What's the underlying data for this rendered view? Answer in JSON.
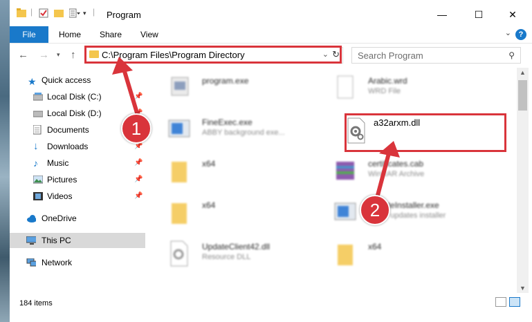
{
  "window": {
    "title": "Program",
    "minimize": "—",
    "maximize": "☐",
    "close": "✕"
  },
  "ribbon": {
    "tabs": [
      "File",
      "Home",
      "Share",
      "View"
    ],
    "help": "?"
  },
  "address": {
    "path": "C:\\Program Files\\Program Directory"
  },
  "search": {
    "placeholder": "Search Program"
  },
  "nav_pane": {
    "items": [
      {
        "label": "Quick access",
        "icon": "star-icon"
      },
      {
        "label": "Local Disk (C:)",
        "icon": "drive-icon"
      },
      {
        "label": "Local Disk (D:)",
        "icon": "drive-icon"
      },
      {
        "label": "Documents",
        "icon": "documents-icon"
      },
      {
        "label": "Downloads",
        "icon": "download-icon"
      },
      {
        "label": "Music",
        "icon": "music-icon"
      },
      {
        "label": "Pictures",
        "icon": "pictures-icon"
      },
      {
        "label": "Videos",
        "icon": "videos-icon"
      },
      {
        "label": "OneDrive",
        "icon": "cloud-icon"
      },
      {
        "label": "This PC",
        "icon": "computer-icon"
      },
      {
        "label": "Network",
        "icon": "network-icon"
      }
    ]
  },
  "files": [
    {
      "name": "program.exe",
      "desc": "",
      "icon": "exe-icon"
    },
    {
      "name": "Arabic.wrd",
      "desc": "WRD File",
      "icon": "file-icon"
    },
    {
      "name": "FineExec.exe",
      "desc": "ABBY background exe...",
      "icon": "exe-icon"
    },
    {
      "name": "a32arxm.dll",
      "desc": "",
      "icon": "dll-gear-icon"
    },
    {
      "name": "x64",
      "desc": "",
      "icon": "folder-icon"
    },
    {
      "name": "certificates.cab",
      "desc": "WinRAR Archive",
      "icon": "archive-icon"
    },
    {
      "name": "x64",
      "desc": "",
      "icon": "folder-icon"
    },
    {
      "name": "UpdateInstaller.exe",
      "desc": "ABBY updates installer",
      "icon": "exe-icon"
    },
    {
      "name": "UpdateClient42.dll",
      "desc": "Resource DLL",
      "icon": "dll-gear-icon"
    },
    {
      "name": "x64",
      "desc": "",
      "icon": "folder-icon"
    }
  ],
  "status": {
    "count": "184 items"
  },
  "callouts": [
    "1",
    "2"
  ],
  "colors": {
    "accent": "#1979ca",
    "highlight": "#d9343b",
    "folder": "#f4c64d"
  }
}
